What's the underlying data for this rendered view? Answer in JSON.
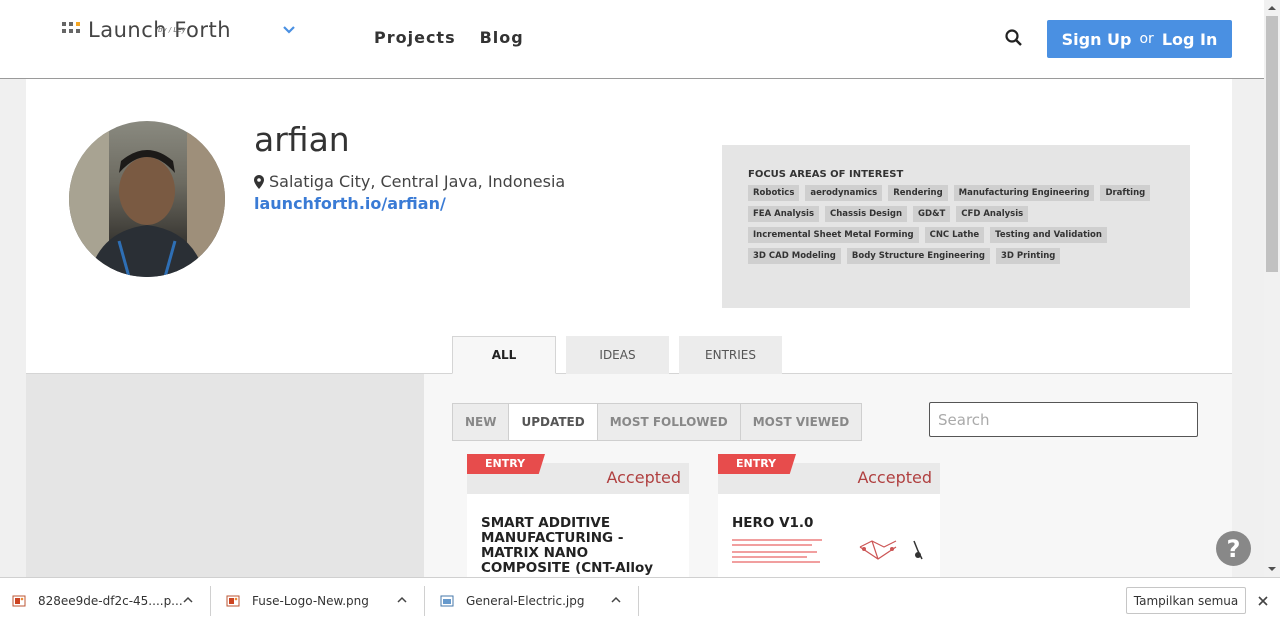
{
  "header": {
    "logo_text": "Launch Forth",
    "logo_by": "by / Ley",
    "nav": {
      "projects": "Projects",
      "blog": "Blog"
    },
    "auth": {
      "signup": "Sign Up",
      "or": "or",
      "login": "Log In"
    }
  },
  "profile": {
    "username": "arfian",
    "location": "Salatiga City, Central Java, Indonesia",
    "link": "launchforth.io/arfian/"
  },
  "focus": {
    "title": "FOCUS AREAS OF INTEREST",
    "tags": [
      "Robotics",
      "aerodynamics",
      "Rendering",
      "Manufacturing Engineering",
      "Drafting",
      "FEA Analysis",
      "Chassis Design",
      "GD&T",
      "CFD Analysis",
      "Incremental Sheet Metal Forming",
      "CNC Lathe",
      "Testing and Validation",
      "3D CAD Modeling",
      "Body Structure Engineering",
      "3D Printing"
    ]
  },
  "tabs": {
    "all": "ALL",
    "ideas": "IDEAS",
    "entries": "ENTRIES"
  },
  "sort": {
    "new": "NEW",
    "updated": "UPDATED",
    "most_followed": "MOST FOLLOWED",
    "most_viewed": "MOST VIEWED"
  },
  "search": {
    "placeholder": "Search"
  },
  "cards": [
    {
      "ribbon": "ENTRY",
      "status": "Accepted",
      "title": "SMART ADDITIVE MANUFACTURING - MATRIX NANO COMPOSITE (CNT-Alloy Steel)"
    },
    {
      "ribbon": "ENTRY",
      "status": "Accepted",
      "title": "HERO V1.0"
    }
  ],
  "help": {
    "label": "?"
  },
  "downloads": {
    "items": [
      "828ee9de-df2c-45....p...",
      "Fuse-Logo-New.png",
      "General-Electric.jpg"
    ],
    "show_all": "Tampilkan semua"
  },
  "colors": {
    "accent": "#4a90e2",
    "ribbon": "#e74c4c",
    "status": "#b04040",
    "link": "#3a7bd5"
  }
}
